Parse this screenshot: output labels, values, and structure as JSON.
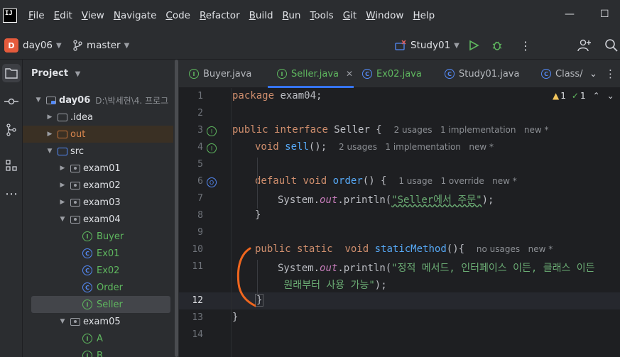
{
  "menu": {
    "logo": "IJ",
    "items": [
      "File",
      "Edit",
      "View",
      "Navigate",
      "Code",
      "Refactor",
      "Build",
      "Run",
      "Tools",
      "Git",
      "Window",
      "Help"
    ],
    "mnemonics": [
      "F",
      "E",
      "V",
      "N",
      "C",
      "R",
      "B",
      "R",
      "T",
      "G",
      "W",
      "H"
    ]
  },
  "window": {
    "minimize": "—",
    "maximize": "☐"
  },
  "toolbar": {
    "project_badge": "D",
    "project_name": "day06",
    "branch": "master",
    "run_config": "Study01"
  },
  "project_panel": {
    "title": "Project",
    "root": {
      "name": "day06",
      "path": "D:\\박세현\\4. 프로그"
    },
    "items": {
      "idea": ".idea",
      "out": "out",
      "src": "src",
      "exam01": "exam01",
      "exam02": "exam02",
      "exam03": "exam03",
      "exam04": "exam04",
      "buyer": "Buyer",
      "ex01": "Ex01",
      "ex02": "Ex02",
      "order": "Order",
      "seller": "Seller",
      "exam05": "exam05",
      "a": "A",
      "b": "B"
    }
  },
  "tabs": [
    {
      "label": "Buyer.java",
      "icon": "interface-icon"
    },
    {
      "label": "Seller.java",
      "icon": "interface-icon",
      "active": true
    },
    {
      "label": "Ex02.java",
      "icon": "class-run-icon"
    },
    {
      "label": "Study01.java",
      "icon": "class-icon"
    },
    {
      "label": "Class/",
      "icon": "class-icon"
    }
  ],
  "inspections": {
    "warnings": "1",
    "ok": "1"
  },
  "editor": {
    "line_numbers": [
      "1",
      "2",
      "3",
      "4",
      "5",
      "6",
      "7",
      "8",
      "9",
      "10",
      "11",
      "12",
      "13",
      "14"
    ],
    "current_line": "12",
    "l1": {
      "kw": "package",
      "rest": " exam04;"
    },
    "l3": {
      "kw1": "public",
      "kw2": "interface",
      "name": " Seller {",
      "hint": "2 usages   1 implementation   new *"
    },
    "l4": {
      "kw": "void",
      "fn": "sell",
      "rest": "();",
      "hint": "2 usages   1 implementation   new *"
    },
    "l6": {
      "kw1": "default",
      "kw2": "void",
      "fn": "order",
      "rest": "() {",
      "hint": "1 usage   1 override   new *"
    },
    "l7": {
      "pre": "System.",
      "out": "out",
      "mid": ".println(",
      "str": "\"Seller에서 주문\"",
      "end": ");"
    },
    "l8": {
      "text": "}"
    },
    "l10": {
      "kw1": "public",
      "kw2": "static",
      "kw3": "void",
      "fn": "staticMethod",
      "rest": "(){",
      "hint": "no usages   new *"
    },
    "l11": {
      "pre": "System.",
      "out": "out",
      "mid": ".println(",
      "str": "\"정적 메서드, 인터페이스 이든, 클래스 이든"
    },
    "l11b": {
      "str": " 원래부터 사용 가능\"",
      "end": ");"
    },
    "l12": {
      "text": "}"
    },
    "l13": {
      "text": "}"
    }
  },
  "colors": {
    "accent": "#3574f0",
    "annotation": "#f0661e",
    "keyword": "#cf8e6d",
    "string": "#6aab73",
    "function": "#56a8f5"
  }
}
